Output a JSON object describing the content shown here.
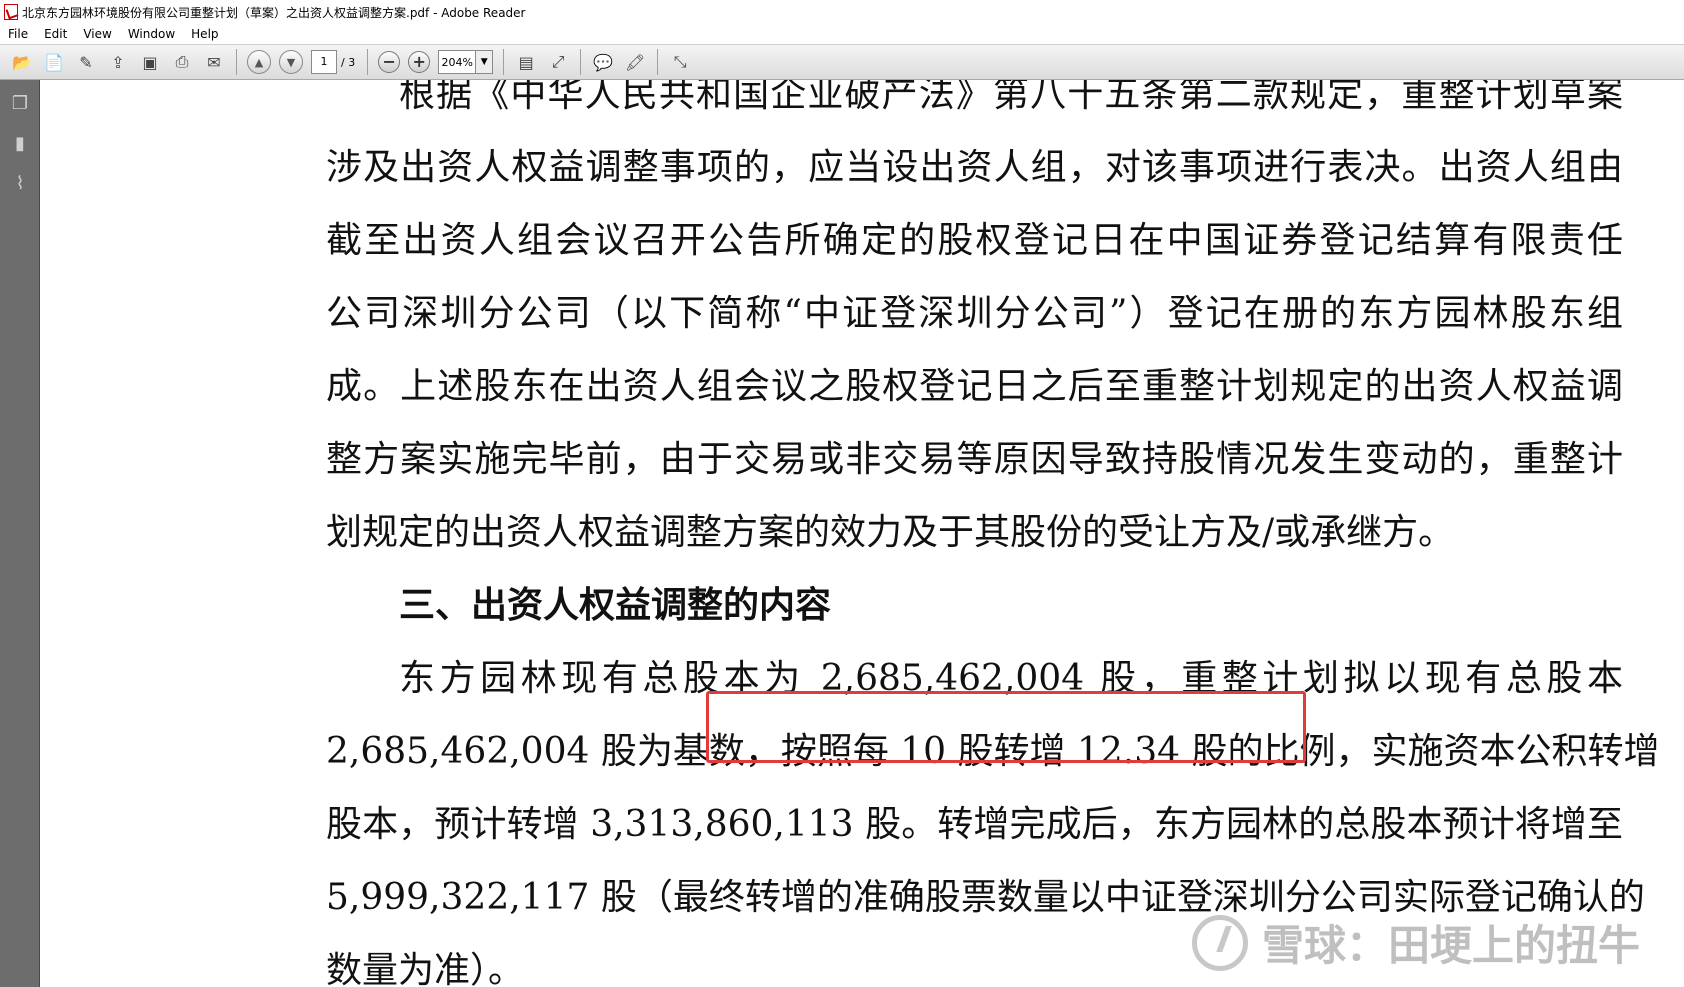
{
  "window": {
    "title": "北京东方园林环境股份有限公司重整计划（草案）之出资人权益调整方案.pdf - Adobe Reader"
  },
  "menu": {
    "items": [
      "File",
      "Edit",
      "View",
      "Window",
      "Help"
    ]
  },
  "toolbar": {
    "page_current": "1",
    "page_total": "/ 3",
    "zoom": "204%"
  },
  "document": {
    "lines": [
      "根据《中华人民共和国企业破产法》第八十五条第二款规定，重整计划草案",
      "涉及出资人权益调整事项的，应当设出资人组，对该事项进行表决。出资人组由",
      "截至出资人组会议召开公告所确定的股权登记日在中国证券登记结算有限责任",
      "公司深圳分公司（以下简称“中证登深圳分公司”）登记在册的东方园林股东组",
      "成。上述股东在出资人组会议之股权登记日之后至重整计划规定的出资人权益调",
      "整方案实施完毕前，由于交易或非交易等原因导致持股情况发生变动的，重整计",
      "划规定的出资人权益调整方案的效力及于其股份的受让方及/或承继方。"
    ],
    "heading": "三、出资人权益调整的内容",
    "para2": [
      "东方园林现有总股本为 2,685,462,004 股，重整计划拟以现有总股本",
      "2,685,462,004 股为基数，按照每 10 股转增 12.34 股的比例，实施资本公积转增",
      "股本，预计转增 3,313,860,113 股。转增完成后，东方园林的总股本预计将增至",
      "5,999,322,117 股（最终转增的准确股票数量以中证登深圳分公司实际登记确认的",
      "数量为准）。"
    ]
  },
  "watermark": {
    "text": "雪球：田埂上的扭牛"
  },
  "colors": {
    "highlight_border": "#e23b3b",
    "sidebar": "#6d6d6d"
  }
}
